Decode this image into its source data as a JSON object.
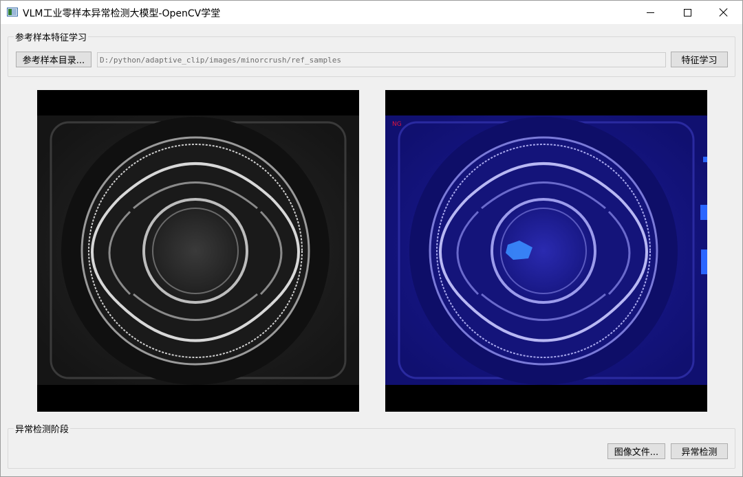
{
  "window": {
    "title": "VLM工业零样本异常检测大模型-OpenCV学堂"
  },
  "ref_group": {
    "title": "参考样本特征学习",
    "dir_button_label": "参考样本目录...",
    "path_value": "D:/python/adaptive_clip/images/minorcrush/ref_samples",
    "learn_button_label": "特征学习"
  },
  "viewers": {
    "right_status": "NG"
  },
  "detect_group": {
    "title": "异常检测阶段",
    "file_button_label": "图像文件...",
    "detect_button_label": "异常检测"
  },
  "colors": {
    "overlay_blue": "#1a1a8c",
    "anomaly_highlight": "#3a8cff",
    "ng_text": "#e0143c"
  }
}
